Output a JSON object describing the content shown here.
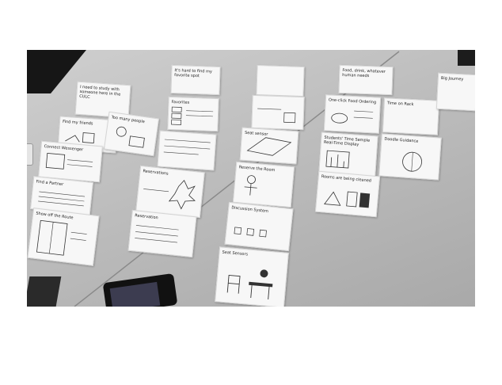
{
  "photo": {
    "description_free": true,
    "notes": [
      {
        "id": "n1",
        "text": "I need to study with someone here in the CULC"
      },
      {
        "id": "n2",
        "text": "Find my friends"
      },
      {
        "id": "n3",
        "text": "Too many people"
      },
      {
        "id": "n4",
        "text": "Connect Wessenger"
      },
      {
        "id": "n5",
        "text": "Find a Partner"
      },
      {
        "id": "n6",
        "text": "Show off the Route"
      },
      {
        "id": "n7",
        "text": "It's hard to find my favorite spot"
      },
      {
        "id": "n8",
        "text": "Favorites"
      },
      {
        "id": "n9",
        "text": ""
      },
      {
        "id": "n10",
        "text": "Reservations"
      },
      {
        "id": "n11",
        "text": "Reservation"
      },
      {
        "id": "n12",
        "text": ""
      },
      {
        "id": "n13",
        "text": ""
      },
      {
        "id": "n14",
        "text": "Seat sensor"
      },
      {
        "id": "n15",
        "text": "Reserve the Room"
      },
      {
        "id": "n16",
        "text": "Discussion System"
      },
      {
        "id": "n17",
        "text": "Seat Sensors"
      },
      {
        "id": "n18",
        "text": "Food, drink, whatever human needs"
      },
      {
        "id": "n19",
        "text": "Time on Rack"
      },
      {
        "id": "n20",
        "text": "One-click Food Ordering"
      },
      {
        "id": "n21",
        "text": "Students' Time Sample Real-Time Display"
      },
      {
        "id": "n22",
        "text": "Doodle Guidance"
      },
      {
        "id": "n23",
        "text": "Rooms are being cleaned"
      },
      {
        "id": "n24",
        "text": "Big Journey"
      }
    ]
  }
}
